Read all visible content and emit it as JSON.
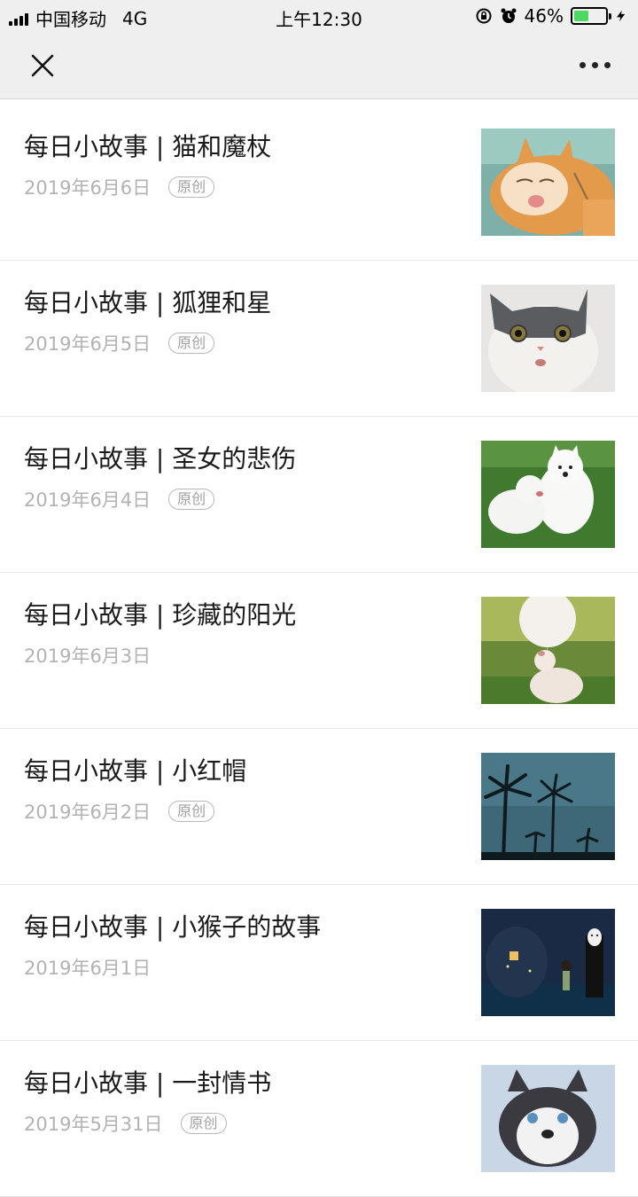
{
  "status_bar": {
    "carrier": "中国移动",
    "network": "4G",
    "time": "上午12:30",
    "battery_percent": "46%",
    "battery_level": 0.46,
    "battery_color": "#4cd964"
  },
  "nav": {
    "close_icon": "close-icon",
    "more_icon": "more-icon"
  },
  "articles": [
    {
      "title": "每日小故事 | 猫和魔杖",
      "date": "2019年6月6日",
      "badge": "原创",
      "thumb": "cat-orange"
    },
    {
      "title": "每日小故事 | 狐狸和星",
      "date": "2019年6月5日",
      "badge": "原创",
      "thumb": "cat-gray"
    },
    {
      "title": "每日小故事 | 圣女的悲伤",
      "date": "2019年6月4日",
      "badge": "原创",
      "thumb": "white-dogs"
    },
    {
      "title": "每日小故事 | 珍藏的阳光",
      "date": "2019年6月3日",
      "badge": "",
      "thumb": "dog-balloon"
    },
    {
      "title": "每日小故事 | 小红帽",
      "date": "2019年6月2日",
      "badge": "原创",
      "thumb": "palm-trees"
    },
    {
      "title": "每日小故事 | 小猴子的故事",
      "date": "2019年6月1日",
      "badge": "",
      "thumb": "anime-night"
    },
    {
      "title": "每日小故事 | 一封情书",
      "date": "2019年5月31日",
      "badge": "原创",
      "thumb": "husky"
    }
  ]
}
